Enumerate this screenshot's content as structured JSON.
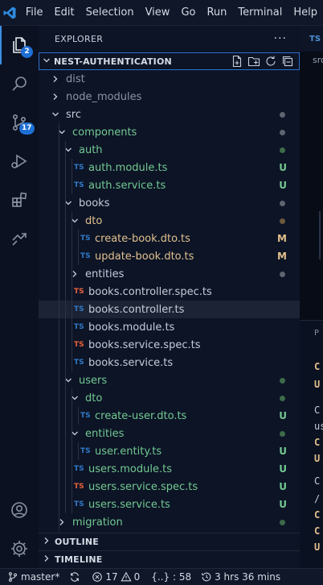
{
  "menu": [
    "File",
    "Edit",
    "Selection",
    "View",
    "Go",
    "Run",
    "Terminal",
    "Help"
  ],
  "activity": {
    "explorer_badge": "2",
    "scm_badge": "17"
  },
  "sidebar": {
    "title": "EXPLORER",
    "more": "···",
    "project": "NEST-AUTHENTICATION",
    "outline": "OUTLINE",
    "timeline": "TIMELINE"
  },
  "tree": [
    {
      "label": "dist",
      "type": "folder",
      "expanded": false,
      "depth": 0,
      "color": "#8c94a3"
    },
    {
      "label": "node_modules",
      "type": "folder",
      "expanded": false,
      "depth": 0,
      "color": "#8c94a3"
    },
    {
      "label": "src",
      "type": "folder",
      "expanded": true,
      "depth": 0,
      "color": "#c5ccd8",
      "dot": "#5f6470"
    },
    {
      "label": "components",
      "type": "folder",
      "expanded": true,
      "depth": 1,
      "color": "#73c991",
      "dot": "#5f6470"
    },
    {
      "label": "auth",
      "type": "folder",
      "expanded": true,
      "depth": 2,
      "color": "#73c991",
      "dot": "#3d6b4a"
    },
    {
      "label": "auth.module.ts",
      "type": "ts",
      "depth": 3,
      "color": "#73c991",
      "decoration": "U",
      "deco_color": "#73c991"
    },
    {
      "label": "auth.service.ts",
      "type": "ts",
      "depth": 3,
      "color": "#73c991",
      "decoration": "U",
      "deco_color": "#73c991"
    },
    {
      "label": "books",
      "type": "folder",
      "expanded": true,
      "depth": 2,
      "color": "#c5ccd8",
      "dot": "#5f6470"
    },
    {
      "label": "dto",
      "type": "folder",
      "expanded": true,
      "depth": 3,
      "color": "#e2c08d",
      "dot": "#6b5a3c"
    },
    {
      "label": "create-book.dto.ts",
      "type": "ts",
      "depth": 4,
      "color": "#e2c08d",
      "decoration": "M",
      "deco_color": "#e2c08d"
    },
    {
      "label": "update-book.dto.ts",
      "type": "ts",
      "depth": 4,
      "color": "#e2c08d",
      "decoration": "M",
      "deco_color": "#e2c08d"
    },
    {
      "label": "entities",
      "type": "folder",
      "expanded": false,
      "depth": 3,
      "color": "#c5ccd8",
      "dot": "#5f6470"
    },
    {
      "label": "books.controller.spec.ts",
      "type": "spec",
      "depth": 3,
      "color": "#c5ccd8"
    },
    {
      "label": "books.controller.ts",
      "type": "ts",
      "depth": 3,
      "color": "#c5ccd8",
      "selected": true
    },
    {
      "label": "books.module.ts",
      "type": "ts",
      "depth": 3,
      "color": "#c5ccd8"
    },
    {
      "label": "books.service.spec.ts",
      "type": "spec",
      "depth": 3,
      "color": "#c5ccd8"
    },
    {
      "label": "books.service.ts",
      "type": "ts",
      "depth": 3,
      "color": "#c5ccd8"
    },
    {
      "label": "users",
      "type": "folder",
      "expanded": true,
      "depth": 2,
      "color": "#73c991",
      "dot": "#3d6b4a"
    },
    {
      "label": "dto",
      "type": "folder",
      "expanded": true,
      "depth": 3,
      "color": "#73c991",
      "dot": "#3d6b4a"
    },
    {
      "label": "create-user.dto.ts",
      "type": "ts",
      "depth": 4,
      "color": "#73c991",
      "decoration": "U",
      "deco_color": "#73c991"
    },
    {
      "label": "entities",
      "type": "folder",
      "expanded": true,
      "depth": 3,
      "color": "#73c991",
      "dot": "#3d6b4a"
    },
    {
      "label": "user.entity.ts",
      "type": "ts",
      "depth": 4,
      "color": "#73c991",
      "decoration": "U",
      "deco_color": "#73c991"
    },
    {
      "label": "users.module.ts",
      "type": "ts",
      "depth": 3,
      "color": "#73c991",
      "decoration": "U",
      "deco_color": "#73c991"
    },
    {
      "label": "users.service.spec.ts",
      "type": "spec",
      "depth": 3,
      "color": "#73c991",
      "decoration": "U",
      "deco_color": "#73c991"
    },
    {
      "label": "users.service.ts",
      "type": "ts",
      "depth": 3,
      "color": "#73c991",
      "decoration": "U",
      "deco_color": "#73c991"
    },
    {
      "label": "migration",
      "type": "folder",
      "expanded": false,
      "depth": 1,
      "color": "#73c991",
      "dot": "#3d6b4a"
    }
  ],
  "editor": {
    "tab_prefix": "TS",
    "breadcrumb": "src",
    "panel_label": "P",
    "fragments": [
      "C",
      "U",
      "C",
      "us",
      "C",
      "U",
      "C",
      "/",
      "C",
      "C",
      "U",
      "C"
    ]
  },
  "statusbar": {
    "branch": "master*",
    "errors": "17",
    "warnings": "0",
    "braces": "{..} : 58",
    "time": "3 hrs 36 mins"
  },
  "colors": {
    "ts_icon": "#3178c6",
    "spec_icon": "#e8613b",
    "accent": "#3c8fe4",
    "untracked": "#73c991",
    "modified": "#e2c08d"
  }
}
